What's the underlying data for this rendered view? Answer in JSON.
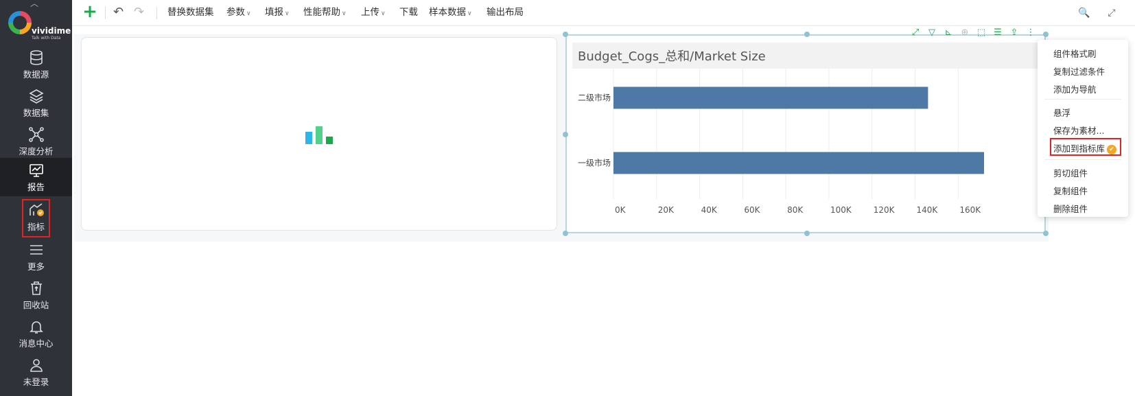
{
  "sidebar": {
    "logo": {
      "brand": "vividime",
      "tagline": "Talk with Data"
    },
    "items": [
      {
        "label": "数据源",
        "icon": "database-icon"
      },
      {
        "label": "数据集",
        "icon": "layers-icon"
      },
      {
        "label": "深度分析",
        "icon": "network-icon"
      },
      {
        "label": "报告",
        "icon": "monitor-chart-icon",
        "active": true
      },
      {
        "label": "指标",
        "icon": "metric-trend-icon",
        "boxed": true
      },
      {
        "label": "更多",
        "icon": "menu-lines-icon"
      },
      {
        "label": "回收站",
        "icon": "recycle-bin-icon"
      },
      {
        "label": "消息中心",
        "icon": "bell-icon"
      },
      {
        "label": "未登录",
        "icon": "user-icon"
      }
    ]
  },
  "toolbar": {
    "items": [
      {
        "label": "替换数据集",
        "dropdown": false
      },
      {
        "label": "参数",
        "dropdown": true
      },
      {
        "label": "填报",
        "dropdown": true
      },
      {
        "label": "性能帮助",
        "dropdown": true
      },
      {
        "label": "上传",
        "dropdown": true
      },
      {
        "label": "下载",
        "dropdown": false
      },
      {
        "label": "样本数据",
        "dropdown": true
      },
      {
        "label": "输出布局",
        "dropdown": false
      }
    ]
  },
  "chart_data": {
    "type": "bar",
    "orientation": "horizontal",
    "title": "Budget_Cogs_总和/Market Size",
    "categories": [
      "二级市场",
      "一级市场"
    ],
    "values": [
      146000,
      172000
    ],
    "xticks": [
      "0K",
      "20K",
      "40K",
      "60K",
      "80K",
      "100K",
      "120K",
      "140K",
      "160K"
    ],
    "xlim": [
      0,
      172000
    ],
    "grid": true,
    "bar_color": "#4e79a7"
  },
  "context_menu": {
    "items": [
      {
        "label": "组件格式刷"
      },
      {
        "label": "复制过滤条件"
      },
      {
        "label": "添加为导航"
      },
      {
        "label": "悬浮"
      },
      {
        "label": "保存为素材..."
      },
      {
        "label": "添加到指标库",
        "highlighted": true,
        "badge_icon": "metric-badge-icon"
      },
      {
        "label": "剪切组件"
      },
      {
        "label": "复制组件"
      },
      {
        "label": "删除组件"
      }
    ]
  }
}
